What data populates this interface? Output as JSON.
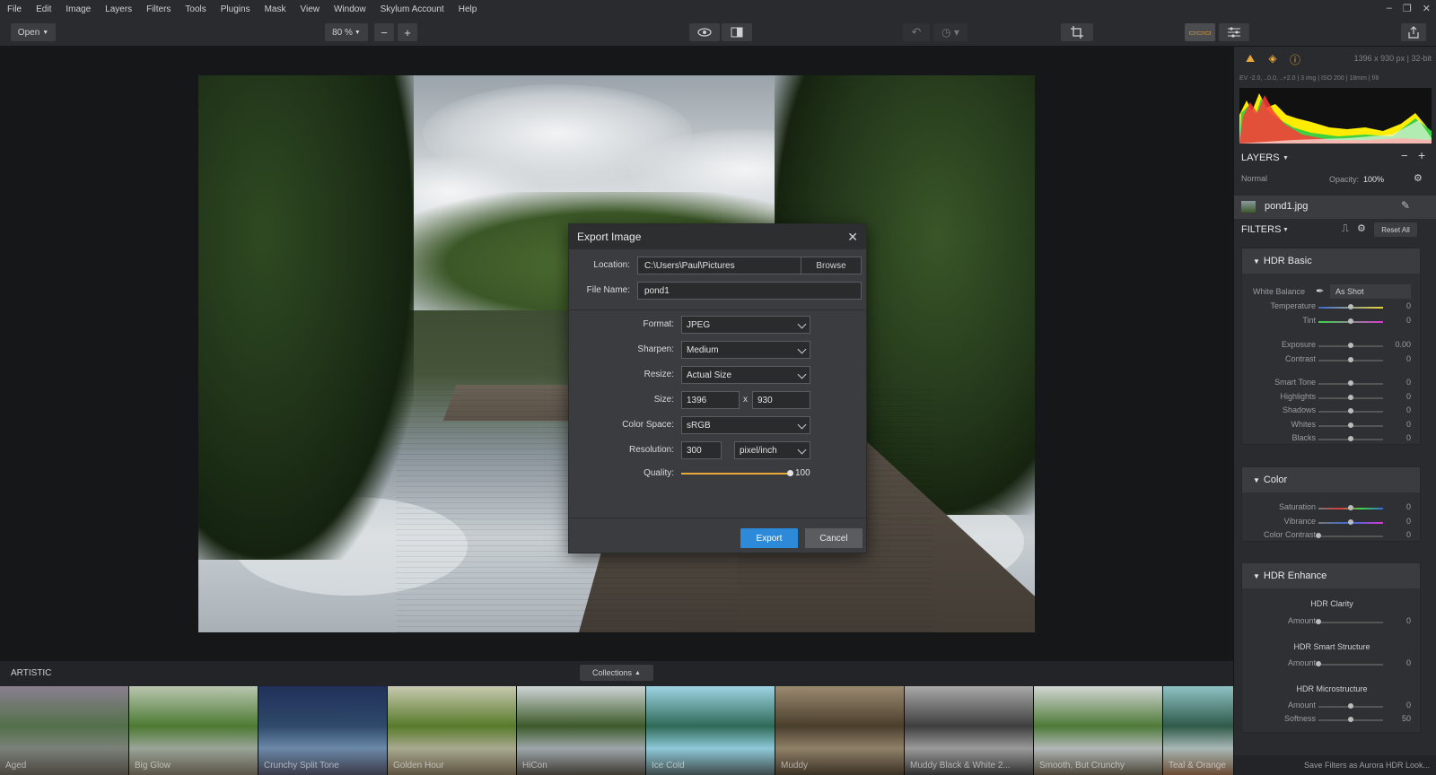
{
  "menu": [
    "File",
    "Edit",
    "Image",
    "Layers",
    "Filters",
    "Tools",
    "Plugins",
    "Mask",
    "View",
    "Window",
    "Skylum Account",
    "Help"
  ],
  "toolbar": {
    "open_label": "Open",
    "zoom_label": "80 %"
  },
  "image_info": {
    "dims": "1396 x 930 px  |  32-bit",
    "exif": "EV -2.0, ..0.0, ..+2.0  |  3 img  |  ISO 200  |  18mm  |  f/8"
  },
  "layers": {
    "title": "LAYERS",
    "blend": "Normal",
    "opacity_label": "Opacity:",
    "opacity_value": "100%",
    "layer_name": "pond1.jpg"
  },
  "filters": {
    "title": "FILTERS",
    "reset_label": "Reset All",
    "groups": {
      "hdr_basic": {
        "title": "HDR Basic",
        "wb_label": "White Balance",
        "wb_value": "As Shot",
        "rows": [
          {
            "name": "Temperature",
            "value": "0",
            "pos": 0.5
          },
          {
            "name": "Tint",
            "value": "0",
            "pos": 0.5
          },
          {
            "name": "Exposure",
            "value": "0.00",
            "pos": 0.5
          },
          {
            "name": "Contrast",
            "value": "0",
            "pos": 0.5
          },
          {
            "name": "Smart Tone",
            "value": "0",
            "pos": 0.5
          },
          {
            "name": "Highlights",
            "value": "0",
            "pos": 0.5
          },
          {
            "name": "Shadows",
            "value": "0",
            "pos": 0.5
          },
          {
            "name": "Whites",
            "value": "0",
            "pos": 0.5
          },
          {
            "name": "Blacks",
            "value": "0",
            "pos": 0.5
          }
        ]
      },
      "color": {
        "title": "Color",
        "rows": [
          {
            "name": "Saturation",
            "value": "0",
            "pos": 0.5
          },
          {
            "name": "Vibrance",
            "value": "0",
            "pos": 0.5
          },
          {
            "name": "Color Contrast",
            "value": "0",
            "pos": 0.0
          }
        ]
      },
      "hdr_enhance": {
        "title": "HDR Enhance",
        "sub1": "HDR Clarity",
        "sub2": "HDR Smart Structure",
        "sub3": "HDR Microstructure",
        "rows": [
          {
            "name": "Amount",
            "value": "0",
            "pos": 0.0
          },
          {
            "name": "Amount",
            "value": "0",
            "pos": 0.0
          },
          {
            "name": "Amount",
            "value": "0",
            "pos": 0.5
          },
          {
            "name": "Softness",
            "value": "50",
            "pos": 0.5
          }
        ]
      }
    },
    "footer": "Save Filters as Aurora HDR Look..."
  },
  "filmstrip": {
    "category": "ARTISTIC",
    "collections_label": "Collections",
    "looks": [
      "Aged",
      "Big Glow",
      "Crunchy Split Tone",
      "Golden Hour",
      "HiCon",
      "Ice Cold",
      "Muddy",
      "Muddy Black & White 2...",
      "Smooth, But Crunchy",
      "Teal & Orange"
    ]
  },
  "dialog": {
    "title": "Export Image",
    "location_label": "Location:",
    "location_value": "C:\\Users\\Paul\\Pictures",
    "browse_label": "Browse",
    "filename_label": "File Name:",
    "filename_value": "pond1",
    "format_label": "Format:",
    "format_value": "JPEG",
    "sharpen_label": "Sharpen:",
    "sharpen_value": "Medium",
    "resize_label": "Resize:",
    "resize_value": "Actual Size",
    "size_label": "Size:",
    "size_w": "1396",
    "size_x": "x",
    "size_h": "930",
    "colorspace_label": "Color Space:",
    "colorspace_value": "sRGB",
    "resolution_label": "Resolution:",
    "resolution_value": "300",
    "resolution_unit": "pixel/inch",
    "quality_label": "Quality:",
    "quality_value": "100",
    "quality_pos": 1.0,
    "export_label": "Export",
    "cancel_label": "Cancel"
  },
  "colors": {
    "accent": "#2d8ad8",
    "orange": "#e8a93a"
  }
}
